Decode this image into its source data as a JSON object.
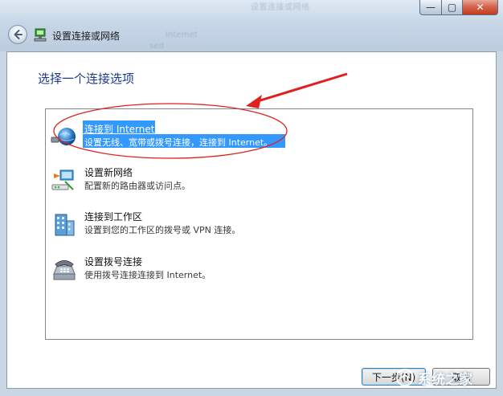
{
  "window": {
    "title_blurred": "设置连接或网络",
    "bg_text_1": "Internet",
    "bg_text_2": "sed",
    "controls": {
      "minimize": "—",
      "maximize": "▢",
      "close": "✕"
    }
  },
  "header": {
    "title": "设置连接或网络"
  },
  "main": {
    "heading": "选择一个连接选项",
    "options": [
      {
        "title": "连接到 Internet",
        "desc": "设置无线、宽带或拨号连接，连接到 Internet。",
        "icon": "globe-network-icon",
        "selected": true
      },
      {
        "title": "设置新网络",
        "desc": "配置新的路由器或访问点。",
        "icon": "new-network-router-icon",
        "selected": false
      },
      {
        "title": "连接到工作区",
        "desc": "设置到您的工作区的拨号或 VPN 连接。",
        "icon": "workplace-building-icon",
        "selected": false
      },
      {
        "title": "设置拨号连接",
        "desc": "使用拨号连接连接到 Internet。",
        "icon": "dialup-phone-icon",
        "selected": false
      }
    ]
  },
  "footer": {
    "next_label": "下一步(N)",
    "cancel_label": "取消"
  },
  "watermark": {
    "text": "系统之家"
  },
  "colors": {
    "selection": "#3399ff",
    "heading": "#1e3a8a",
    "annotation": "#e0201c"
  }
}
